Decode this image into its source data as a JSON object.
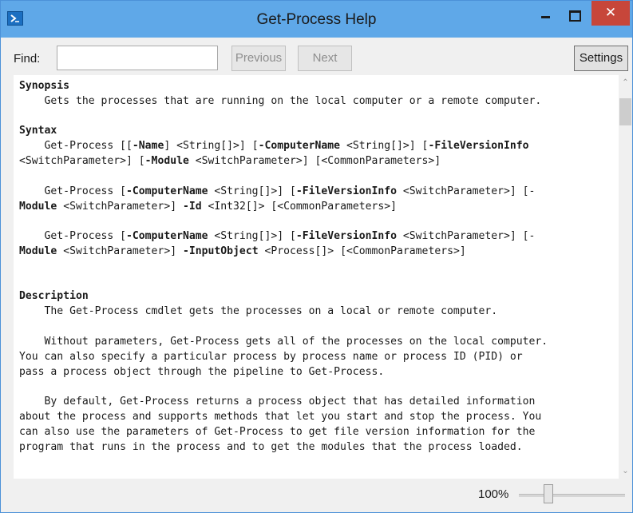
{
  "window": {
    "title": "Get-Process Help",
    "close_glyph": "✕"
  },
  "toolbar": {
    "find_label": "Find:",
    "find_value": "",
    "previous_label": "Previous",
    "next_label": "Next",
    "settings_label": "Settings"
  },
  "help": {
    "synopsis_heading": "Synopsis",
    "synopsis_text": "    Gets the processes that are running on the local computer or a remote computer.",
    "syntax_heading": "Syntax",
    "syntax_1": [
      {
        "t": "    Get-Process [[",
        "b": false
      },
      {
        "t": "-Name",
        "b": true
      },
      {
        "t": "] <String[]>] [",
        "b": false
      },
      {
        "t": "-ComputerName",
        "b": true
      },
      {
        "t": " <String[]>] [",
        "b": false
      },
      {
        "t": "-FileVersionInfo",
        "b": true
      },
      {
        "t": "\n<SwitchParameter>] [",
        "b": false
      },
      {
        "t": "-Module",
        "b": true
      },
      {
        "t": " <SwitchParameter>] [<CommonParameters>]",
        "b": false
      }
    ],
    "syntax_2": [
      {
        "t": "    Get-Process [",
        "b": false
      },
      {
        "t": "-ComputerName",
        "b": true
      },
      {
        "t": " <String[]>] [",
        "b": false
      },
      {
        "t": "-FileVersionInfo",
        "b": true
      },
      {
        "t": " <SwitchParameter>] [-\n",
        "b": false
      },
      {
        "t": "Module",
        "b": true
      },
      {
        "t": " <SwitchParameter>] ",
        "b": false
      },
      {
        "t": "-Id",
        "b": true
      },
      {
        "t": " <Int32[]> [<CommonParameters>]",
        "b": false
      }
    ],
    "syntax_3": [
      {
        "t": "    Get-Process [",
        "b": false
      },
      {
        "t": "-ComputerName",
        "b": true
      },
      {
        "t": " <String[]>] [",
        "b": false
      },
      {
        "t": "-FileVersionInfo",
        "b": true
      },
      {
        "t": " <SwitchParameter>] [-\n",
        "b": false
      },
      {
        "t": "Module",
        "b": true
      },
      {
        "t": " <SwitchParameter>] ",
        "b": false
      },
      {
        "t": "-InputObject",
        "b": true
      },
      {
        "t": " <Process[]> [<CommonParameters>]",
        "b": false
      }
    ],
    "description_heading": "Description",
    "description_1": "    The Get-Process cmdlet gets the processes on a local or remote computer.",
    "description_2": "    Without parameters, Get-Process gets all of the processes on the local computer.\nYou can also specify a particular process by process name or process ID (PID) or\npass a process object through the pipeline to Get-Process.",
    "description_3": "    By default, Get-Process returns a process object that has detailed information\nabout the process and supports methods that let you start and stop the process. You\ncan also use the parameters of Get-Process to get file version information for the\nprogram that runs in the process and to get the modules that the process loaded."
  },
  "status": {
    "zoom_label": "100%",
    "zoom_level_percent": 100
  },
  "scroll": {
    "up_glyph": "⌃",
    "down_glyph": "⌄"
  }
}
